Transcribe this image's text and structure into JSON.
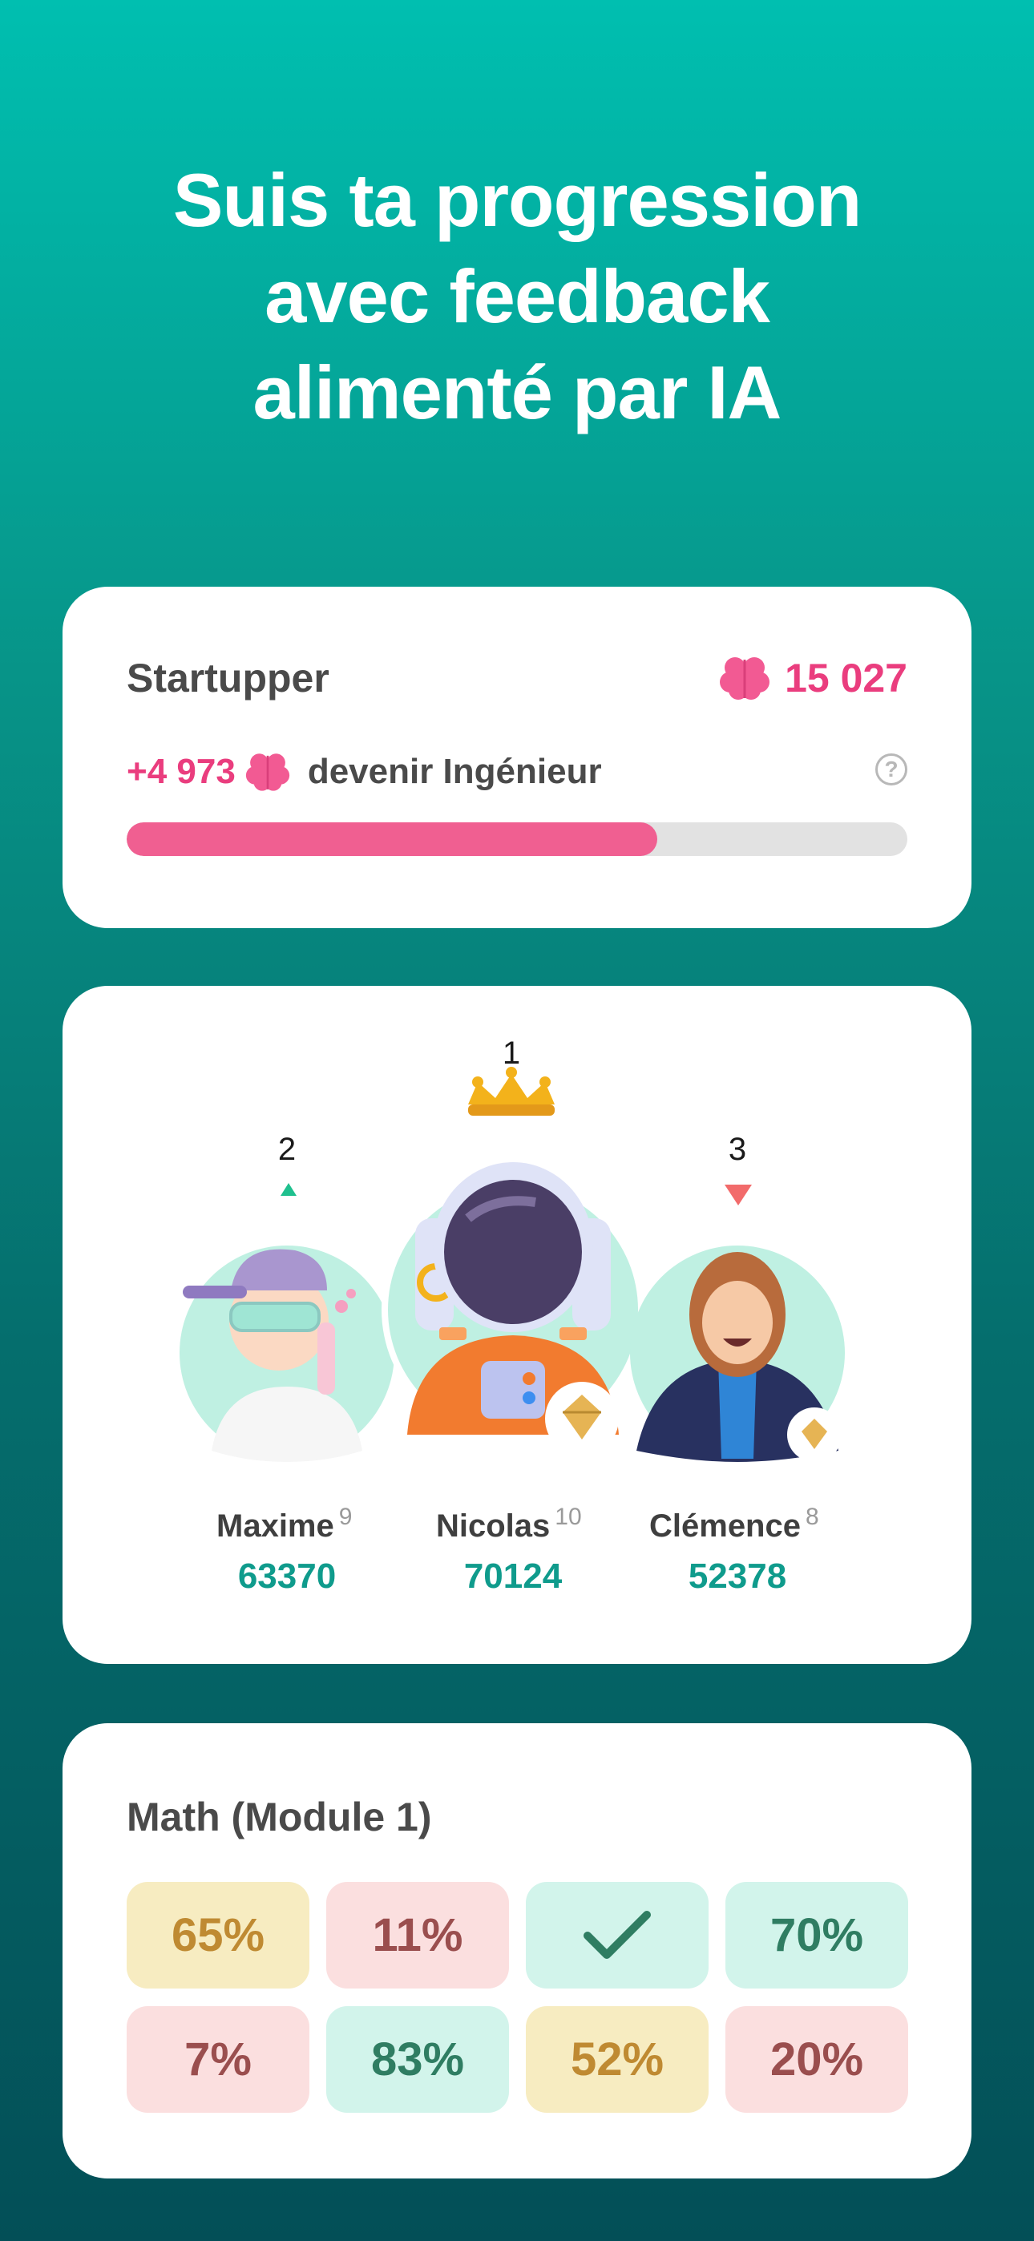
{
  "headline": {
    "line1": "Suis ta progression",
    "line2": "avec feedback",
    "line3": "alimenté par IA"
  },
  "level_card": {
    "rank_title": "Startupper",
    "points": "15 027",
    "next_points": "+4 973",
    "next_label": "devenir Ingénieur",
    "help_symbol": "?",
    "progress_percent": 68,
    "colors": {
      "accent": "#ea3d7e",
      "bar": "#f05f91",
      "track": "#e2e2e2"
    },
    "icon": "brain-icon"
  },
  "leaderboard": {
    "players": [
      {
        "rank": "2",
        "name": "Maxime",
        "level": "9",
        "score": "63370",
        "trend": "up",
        "avatar": "scientist-avatar"
      },
      {
        "rank": "1",
        "name": "Nicolas",
        "level": "10",
        "score": "70124",
        "trend": "crown",
        "avatar": "astronaut-avatar"
      },
      {
        "rank": "3",
        "name": "Clémence",
        "level": "8",
        "score": "52378",
        "trend": "down",
        "avatar": "woman-avatar"
      }
    ],
    "colors": {
      "score": "#0f9b8c",
      "up": "#1fc08e",
      "down": "#f26b6b"
    }
  },
  "module_card": {
    "subject": "Math (Module 1)",
    "tiles": [
      {
        "text": "65%",
        "tone": "yellow"
      },
      {
        "text": "11%",
        "tone": "red"
      },
      {
        "text": "",
        "tone": "green",
        "icon": "check-icon"
      },
      {
        "text": "70%",
        "tone": "green"
      },
      {
        "text": "7%",
        "tone": "red"
      },
      {
        "text": "83%",
        "tone": "green"
      },
      {
        "text": "52%",
        "tone": "yellow"
      },
      {
        "text": "20%",
        "tone": "red"
      }
    ]
  }
}
